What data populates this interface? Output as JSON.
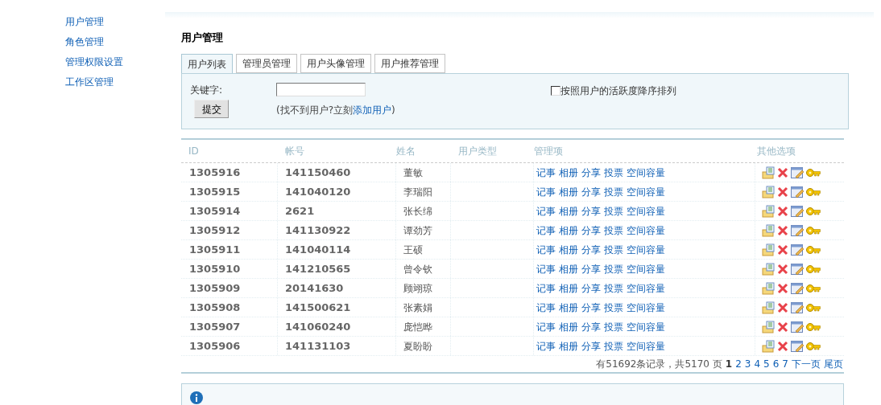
{
  "sidebar": {
    "items": [
      {
        "label": "用户管理"
      },
      {
        "label": "角色管理"
      },
      {
        "label": "管理权限设置"
      },
      {
        "label": "工作区管理"
      }
    ]
  },
  "page_title": "用户管理",
  "tabs": [
    {
      "label": "用户列表",
      "selected": true
    },
    {
      "label": "管理员管理",
      "selected": false
    },
    {
      "label": "用户头像管理",
      "selected": false
    },
    {
      "label": "用户推荐管理",
      "selected": false
    }
  ],
  "search": {
    "keyword_label": "关键字:",
    "submit": "提交",
    "hint_before": "(找不到用户?立刻",
    "hint_link": "添加用户",
    "hint_after": ")",
    "sort_checkbox": {
      "label": "按照用户的活跃度降序排列",
      "checked": false
    }
  },
  "table": {
    "columns": [
      "ID",
      "帐号",
      "姓名",
      "用户类型",
      "管理项",
      "其他选项"
    ],
    "rows": [
      {
        "id": "1305916",
        "account": "141150460",
        "name": "董敏",
        "links": [
          "记事",
          "相册",
          "分享",
          "投票",
          "空间容量"
        ]
      },
      {
        "id": "1305915",
        "account": "141040120",
        "name": "李瑞阳",
        "links": [
          "记事",
          "相册",
          "分享",
          "投票",
          "空间容量"
        ]
      },
      {
        "id": "1305914",
        "account": "2621",
        "name": "张长绵",
        "links": [
          "记事",
          "相册",
          "分享",
          "投票",
          "空间容量"
        ]
      },
      {
        "id": "1305912",
        "account": "141130922",
        "name": "谭劲芳",
        "links": [
          "记事",
          "相册",
          "分享",
          "投票",
          "空间容量"
        ]
      },
      {
        "id": "1305911",
        "account": "141040114",
        "name": "王硕",
        "links": [
          "记事",
          "相册",
          "分享",
          "投票",
          "空间容量"
        ]
      },
      {
        "id": "1305910",
        "account": "141210565",
        "name": "曾令钦",
        "links": [
          "记事",
          "相册",
          "分享",
          "投票",
          "空间容量"
        ]
      },
      {
        "id": "1305909",
        "account": "20141630",
        "name": "顾翊琼",
        "links": [
          "记事",
          "相册",
          "分享",
          "投票",
          "空间容量"
        ]
      },
      {
        "id": "1305908",
        "account": "141500621",
        "name": "张素娟",
        "links": [
          "记事",
          "相册",
          "分享",
          "投票",
          "空间容量"
        ]
      },
      {
        "id": "1305907",
        "account": "141060240",
        "name": "庞恺晔",
        "links": [
          "记事",
          "相册",
          "分享",
          "投票",
          "空间容量"
        ]
      },
      {
        "id": "1305906",
        "account": "141131103",
        "name": "夏盼盼",
        "links": [
          "记事",
          "相册",
          "分享",
          "投票",
          "空间容量"
        ]
      }
    ]
  },
  "pager": {
    "summary": "有51692条记录，共5170 页",
    "pages": [
      {
        "label": "1",
        "selected": true
      },
      {
        "label": "2",
        "selected": false
      },
      {
        "label": "3",
        "selected": false
      },
      {
        "label": "4",
        "selected": false
      },
      {
        "label": "5",
        "selected": false
      },
      {
        "label": "6",
        "selected": false
      },
      {
        "label": "7",
        "selected": false
      }
    ],
    "next": "下一页",
    "last": "尾页"
  }
}
